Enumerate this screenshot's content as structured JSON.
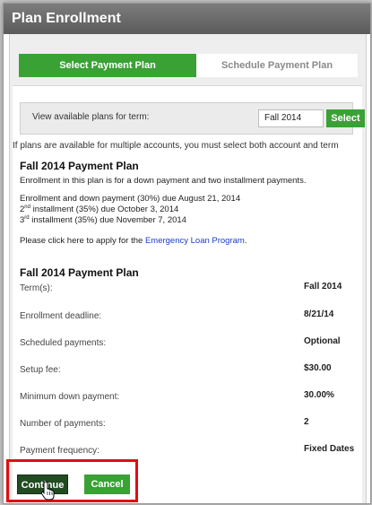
{
  "header": {
    "title": "Plan Enrollment"
  },
  "tabs": [
    {
      "label": "Select Payment Plan",
      "active": true
    },
    {
      "label": "Schedule Payment Plan",
      "active": false
    }
  ],
  "term_selector": {
    "label": "View available plans for term:",
    "value": "Fall 2014",
    "button_label": "Select"
  },
  "multi_account_note": "If plans are available for multiple accounts, you must select both account and term",
  "plan_info": {
    "title": "Fall 2014 Payment Plan",
    "description": "Enrollment in this plan is for a down payment and two installment payments.",
    "schedule": [
      {
        "text": "Enrollment and down payment (30%) due August 21, 2014"
      },
      {
        "num": "2",
        "suffix": "nd",
        "text": " installment (35%) due October 3, 2014"
      },
      {
        "num": "3",
        "suffix": "rd",
        "text": " installment (35%) due November 7, 2014"
      }
    ],
    "apply_prefix": "Please click here to apply for the ",
    "apply_link": "Emergency Loan Program",
    "apply_suffix": "."
  },
  "plan_details": {
    "title": "Fall 2014 Payment Plan",
    "rows": [
      {
        "label": "Term(s):",
        "value": "Fall 2014"
      },
      {
        "label": "Enrollment deadline:",
        "value": "8/21/14"
      },
      {
        "label": "Scheduled payments:",
        "value": "Optional"
      },
      {
        "label": "Setup fee:",
        "value": "$30.00"
      },
      {
        "label": "Minimum down payment:",
        "value": "30.00%"
      },
      {
        "label": "Number of payments:",
        "value": "2"
      },
      {
        "label": "Payment frequency:",
        "value": "Fixed Dates"
      }
    ]
  },
  "actions": {
    "continue_label": "Continue",
    "cancel_label": "Cancel"
  },
  "colors": {
    "accent": "#3aa135",
    "highlight": "#e00d12",
    "header": "#6b6b6b",
    "link": "#1a3fbf"
  }
}
